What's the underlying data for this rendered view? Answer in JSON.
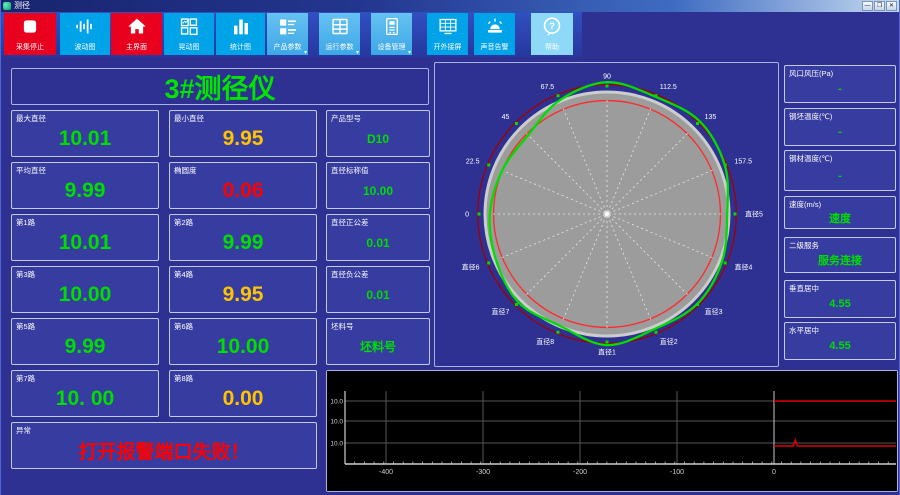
{
  "window": {
    "title": "测径",
    "controls": [
      {
        "name": "minimize-button",
        "glyph": "—"
      },
      {
        "name": "restore-button",
        "glyph": "❐"
      },
      {
        "name": "close-button",
        "glyph": "✕"
      }
    ]
  },
  "toolbar": {
    "buttons": [
      {
        "label": "采集停止",
        "icon": "stop-icon",
        "style": "red"
      },
      {
        "label": "波动图",
        "icon": "waveform-icon",
        "style": "cyan"
      },
      {
        "label": "主界面",
        "icon": "home-icon",
        "style": "red"
      },
      {
        "label": "晃动图",
        "icon": "multiwindow-icon",
        "style": "cyan"
      },
      {
        "label": "统计图",
        "icon": "barchart-icon",
        "style": "cyan"
      },
      {
        "label": "产品参数",
        "icon": "list-icon",
        "style": "light",
        "dropdown": true
      },
      {
        "label": "运行参数",
        "icon": "grid-icon",
        "style": "light",
        "dropdown": true
      },
      {
        "label": "设备管理",
        "icon": "device-icon",
        "style": "light",
        "dropdown": true
      },
      {
        "label": "开外接屏",
        "icon": "screen-icon",
        "style": "cyan"
      },
      {
        "label": "声音告警",
        "icon": "alarm-icon",
        "style": "cyan"
      },
      {
        "label": "帮助",
        "icon": "help-icon",
        "style": "pale"
      }
    ]
  },
  "colors": {
    "green": "#00dd00",
    "yellow": "#ffc400",
    "red": "#ff0000",
    "white": "#ffffff"
  },
  "left_panel": {
    "title": "3#测径仪",
    "main_cells": [
      {
        "label": "最大直径",
        "value": "10.01",
        "color": "green"
      },
      {
        "label": "最小直径",
        "value": "9.95",
        "color": "yellow"
      },
      {
        "label": "平均直径",
        "value": "9.99",
        "color": "green"
      },
      {
        "label": "椭圆度",
        "value": "0.06",
        "color": "red"
      },
      {
        "label": "第1路",
        "value": "10.01",
        "color": "green"
      },
      {
        "label": "第2路",
        "value": "9.99",
        "color": "green"
      },
      {
        "label": "第3路",
        "value": "10.00",
        "color": "green"
      },
      {
        "label": "第4路",
        "value": "9.95",
        "color": "yellow"
      },
      {
        "label": "第5路",
        "value": "9.99",
        "color": "green"
      },
      {
        "label": "第6路",
        "value": "10.00",
        "color": "green"
      },
      {
        "label": "第7路",
        "value": "10. 00",
        "color": "green"
      },
      {
        "label": "第8路",
        "value": "0.00",
        "color": "yellow"
      }
    ],
    "side_cells": [
      {
        "label": "产品型号",
        "value": "D10",
        "color": "green"
      },
      {
        "label": "直径标称值",
        "value": "10.00",
        "color": "green"
      },
      {
        "label": "直径正公差",
        "value": "0.01",
        "color": "green"
      },
      {
        "label": "直径负公差",
        "value": "0.01",
        "color": "green"
      },
      {
        "label": "坯料号",
        "value": "坯料号",
        "color": "green"
      }
    ],
    "alarm": {
      "label": "异常",
      "message": "打开报警端口失败！"
    }
  },
  "right_panel": {
    "items": [
      {
        "label": "风口风压(Pa)",
        "value": "-",
        "color": "green"
      },
      {
        "label": "钢坯温度(℃)",
        "value": "-",
        "color": "green"
      },
      {
        "label": "钢材温度(℃)",
        "value": "-",
        "color": "green"
      },
      {
        "label": "速度(m/s)",
        "value": "速度",
        "color": "green"
      },
      {
        "label": "二级服务",
        "value": "服务连接",
        "color": "green"
      },
      {
        "label": "垂直居中",
        "value": "4.55",
        "color": "green"
      },
      {
        "label": "水平居中",
        "value": "4.55",
        "color": "green"
      }
    ]
  },
  "chart_data": [
    {
      "type": "polar-profile",
      "description": "bar cross-section profile vs tolerance circles",
      "angle_labels": [
        {
          "deg": 180,
          "text": "0"
        },
        {
          "deg": 157.5,
          "text": "22.5"
        },
        {
          "deg": 135,
          "text": "45"
        },
        {
          "deg": 112.5,
          "text": "67.5"
        },
        {
          "deg": 90,
          "text": "90"
        },
        {
          "deg": 67.5,
          "text": "112.5"
        },
        {
          "deg": 45,
          "text": "135"
        },
        {
          "deg": 22.5,
          "text": "157.5"
        },
        {
          "deg": 0,
          "text": "直径5"
        },
        {
          "deg": -22.5,
          "text": "直径4"
        },
        {
          "deg": -45,
          "text": "直径3"
        },
        {
          "deg": -67.5,
          "text": "直径2"
        },
        {
          "deg": -90,
          "text": "直径1"
        },
        {
          "deg": -112.5,
          "text": "直径8"
        },
        {
          "deg": -135,
          "text": "直径7"
        },
        {
          "deg": -157.5,
          "text": "直径6"
        }
      ],
      "circles": {
        "section_ratio": 1.0,
        "tol_inner_ratio": 0.93,
        "tol_outer_ratio": 1.06
      },
      "profile": {
        "angles_deg": [
          0,
          22.5,
          45,
          67.5,
          90,
          112.5,
          135,
          157.5,
          180,
          202.5,
          225,
          247.5,
          270,
          292.5,
          315,
          337.5
        ],
        "radius_ratio": [
          0.985,
          1.045,
          1.075,
          1.04,
          1.08,
          1.01,
          0.915,
          0.93,
          0.96,
          0.985,
          1.025,
          0.995,
          1.075,
          1.02,
          1.045,
          1.02
        ]
      },
      "colors": {
        "section": "#9c9c9c",
        "section_edge": "#cccccc",
        "tol_inner": "#ff2a2a",
        "tol_outer": "#a00000",
        "profile": "#00dd00",
        "spokes": "#f0f0f0",
        "marker": "#00dd00",
        "label": "#ffffff"
      }
    },
    {
      "type": "line",
      "description": "diameter trend strip chart",
      "x_ticks": [
        -400,
        -300,
        -200,
        -100,
        0
      ],
      "xlim": [
        -443,
        127
      ],
      "y_row_labels": [
        "10.0",
        "10.0",
        "10.0"
      ],
      "series": [
        {
          "name": "trace-top",
          "color": "#dd0000",
          "row": 0,
          "x_range": [
            0,
            127
          ]
        },
        {
          "name": "trace-bottom",
          "color": "#dd0000",
          "row": 2,
          "x_range": [
            0,
            127
          ],
          "spike_x": 22
        }
      ],
      "bg": "#000000",
      "grid": "#565656",
      "axis": "#cfcfcf",
      "zero_line": "#c8c8c8"
    }
  ]
}
